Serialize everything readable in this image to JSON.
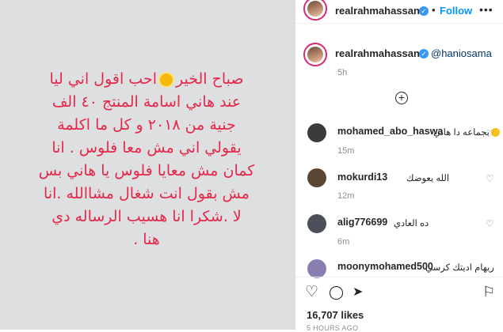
{
  "post": {
    "lines": [
      "صباح الخير",
      "احب اقول اني ليا",
      "عند هاني اسامة المنتج ٤٠ الف",
      "جنية من ٢٠١٨ و كل ما اكلمة",
      "يقولي اني مش معا فلوس . انا",
      "كمان مش معايا فلوس يا هاني بس",
      "مش بقول انت شغال مشاالله .انا",
      "لا .شكرا انا هسيب الرساله دي",
      "هنا ."
    ],
    "sun_icon": "sun-emoji-icon"
  },
  "header": {
    "username": "realrahmahassan",
    "dot": "•",
    "follow_label": "Follow",
    "more_label": "•••"
  },
  "caption": {
    "username": "realrahmahassan",
    "mention": "@haniosama",
    "time": "5h"
  },
  "load_more_label": "+",
  "comments": [
    {
      "username": "mohamed_abo_haswa",
      "text": "بجماعه دا هاني",
      "time": "15m",
      "color": "#3b3b3b"
    },
    {
      "username": "mokurdi13",
      "text": "الله يعوضك",
      "time": "12m",
      "color": "#5a4634"
    },
    {
      "username": "alig776699",
      "text": "ده العادي",
      "time": "6m",
      "color": "#4a4f59"
    },
    {
      "username": "moonymohamed500",
      "text": "ريهام اديتك كرسي",
      "time": "",
      "color": "#8a7db0"
    }
  ],
  "actions": {
    "like_icon": "heart-icon",
    "comment_icon": "comment-icon",
    "share_icon": "share-icon",
    "save_icon": "bookmark-icon"
  },
  "likes": "16,707 likes",
  "posted": "5 HOURS AGO"
}
